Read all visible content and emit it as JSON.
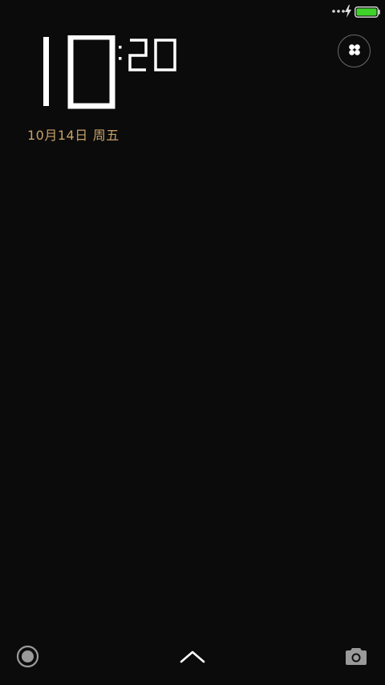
{
  "status_bar": {
    "icons": [
      "more-dots-icon",
      "charging-bolt-icon",
      "battery-icon"
    ],
    "battery_level": 1.0,
    "battery_color": "#3fd22a"
  },
  "clock": {
    "hours": "10",
    "minutes": "20",
    "separator": ":"
  },
  "date": {
    "day": "10月14日",
    "weekday": "周五",
    "color": "#c8a168"
  },
  "controls": {
    "top_right": "clover-apps-icon",
    "bottom_left": "record-ring-icon",
    "bottom_center": "chevron-up-icon",
    "bottom_right": "camera-icon"
  },
  "colors": {
    "background": "#0b0b0b",
    "foreground": "#ffffff",
    "muted": "#9a9a9a"
  }
}
